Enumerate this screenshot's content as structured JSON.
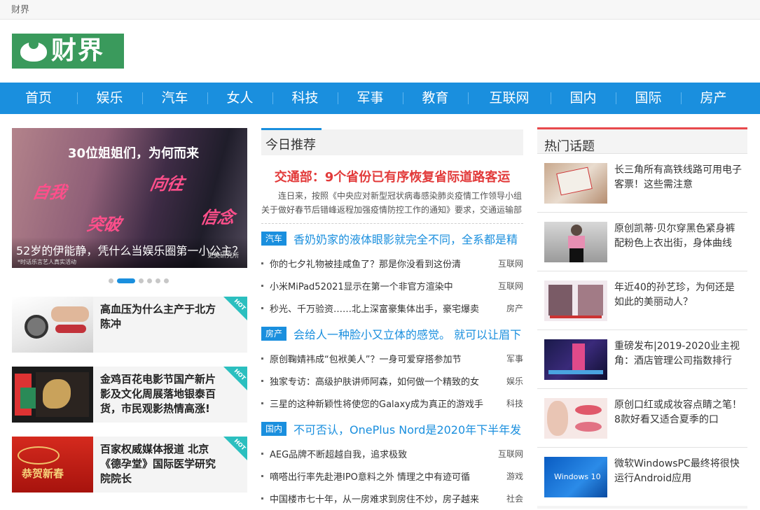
{
  "topbar": {
    "site_name": "财界"
  },
  "logo": {
    "text": "财界"
  },
  "nav": [
    "首页",
    "娱乐",
    "汽车",
    "女人",
    "科技",
    "军事",
    "教育",
    "互联网",
    "国内",
    "国际",
    "房产"
  ],
  "banner": {
    "headline_overlay": "30位姐姐们，为何而来",
    "words": [
      "自我",
      "向往",
      "突破",
      "信念"
    ],
    "caption": "52岁的伊能静，凭什么当娱乐圈第一小公主？",
    "note_left": "*时话乐言艺人真实活动",
    "note_right": "更美研究所"
  },
  "carousel": {
    "count": 6,
    "active": 1
  },
  "cards": [
    {
      "title": "高血压为什么主产于北方陈冲",
      "badge": "HOT"
    },
    {
      "title": "金鸡百花电影节国产新片影及文化周展落地银泰百货，市民观影热情高涨!",
      "badge": "HOT"
    },
    {
      "title": "百家权威媒体报道 北京《德孕堂》国际医学研究院院长",
      "badge": "HOT"
    }
  ],
  "card_thumb_text": {
    "third": "恭贺新春"
  },
  "middle": {
    "title": "今日推荐",
    "headline": "交通部：9个省份已有序恢复省际道路客运",
    "summary": "连日来，按照《中央应对新型冠状病毒感染肺炎疫情工作领导小组关于做好春节后错峰返程加强疫情防控工作的通知》要求，交通运输部",
    "sections": [
      {
        "tag": "汽车",
        "lead": "香奶奶家的液体眼影就完全不同，全系都是精",
        "items": [
          {
            "text": "你的七夕礼物被挂咸鱼了？那是你没看到这份清",
            "cat": "互联网"
          },
          {
            "text": "小米MiPad52021显示在第一个非官方渲染中",
            "cat": "互联网"
          },
          {
            "text": "秒光、千万验资……北上深富豪集体出手，豪宅爆卖",
            "cat": "房产"
          }
        ]
      },
      {
        "tag": "房产",
        "lead": "会给人一种脸小又立体的感觉。 就可以让眉下",
        "items": [
          {
            "text": "原创鞠婧祎成“包袱美人”？一身可爱穿搭参加节",
            "cat": "军事"
          },
          {
            "text": "独家专访：高级护肤讲师阿森，如何做一个精致的女",
            "cat": "娱乐"
          },
          {
            "text": "三星的这种新颖性将使您的Galaxy成为真正的游戏手",
            "cat": "科技"
          }
        ]
      },
      {
        "tag": "国内",
        "lead": "不可否认，OnePlus Nord是2020年下半年发",
        "items": [
          {
            "text": "AEG品牌不断超越自我，追求极致",
            "cat": "互联网"
          },
          {
            "text": "嘀嗒出行率先赴港IPO意料之外 情理之中有迹可循",
            "cat": "游戏"
          },
          {
            "text": "中国楼市七十年，从一房难求到房住不炒，房子越来",
            "cat": "社会"
          }
        ]
      }
    ]
  },
  "right": {
    "title": "热门话题",
    "items": [
      {
        "text": "长三角所有高铁线路可用电子客票！这些需注意"
      },
      {
        "text": "原创凯蒂·贝尔穿黑色紧身裤配粉色上衣出街，身体曲线"
      },
      {
        "text": "年近40的孙艺珍，为何还是如此的美丽动人？"
      },
      {
        "text": "重磅发布|2019-2020业主视角：酒店管理公司指数排行"
      },
      {
        "text": "原创口红或成妆容点睛之笔！8款好看又适合夏季的口"
      },
      {
        "text": "微软WindowsPC最终将很快运行Android应用"
      }
    ],
    "thumb_text": {
      "sixth": "Windows 10"
    }
  }
}
